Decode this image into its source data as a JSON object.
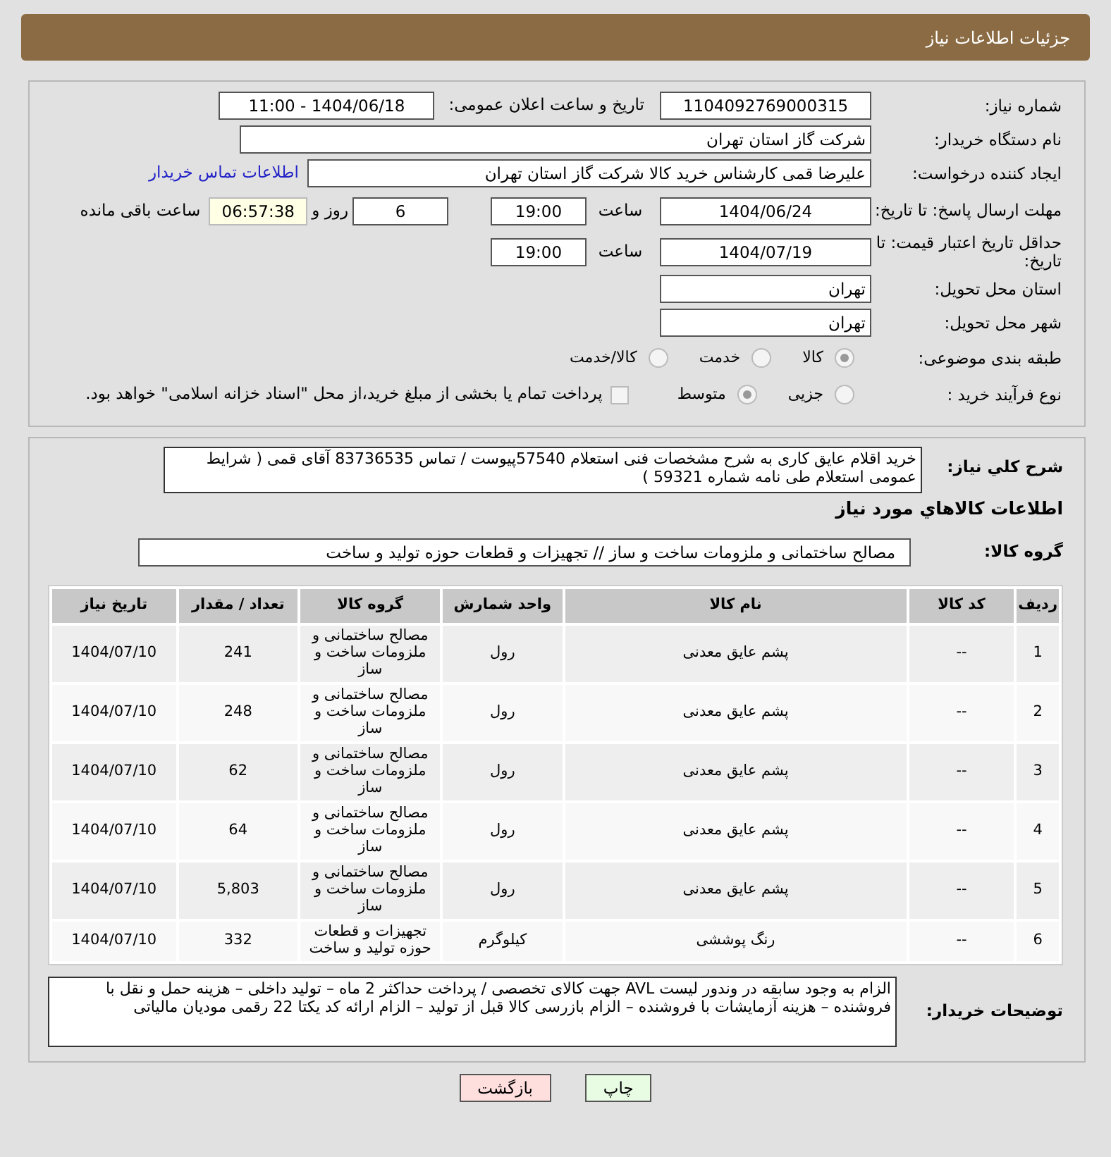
{
  "header": {
    "title": "جزئیات اطلاعات نیاز"
  },
  "details": {
    "need_number": {
      "label": "شماره نیاز:",
      "value": "1104092769000315"
    },
    "announce": {
      "label": "تاریخ و ساعت اعلان عمومی:",
      "value": "1404/06/18 - 11:00"
    },
    "buyer_org": {
      "label": "نام دستگاه خریدار:",
      "value": "شرکت گاز استان تهران"
    },
    "requester": {
      "label": "ایجاد کننده درخواست:",
      "value": "علیرضا قمی کارشناس خرید کالا شرکت گاز استان تهران",
      "link": "اطلاعات تماس خریدار"
    },
    "deadline": {
      "label": "مهلت ارسال پاسخ: تا تاریخ:",
      "date": "1404/06/24",
      "time_label": "ساعت",
      "time": "19:00",
      "days": "6",
      "days_label": "روز و",
      "remaining": "06:57:38",
      "remaining_label": "ساعت باقی مانده"
    },
    "validity": {
      "label": "حداقل تاریخ اعتبار قیمت: تا تاریخ:",
      "date": "1404/07/19",
      "time_label": "ساعت",
      "time": "19:00"
    },
    "province": {
      "label": "استان محل تحویل:",
      "value": "تهران"
    },
    "city": {
      "label": "شهر محل تحویل:",
      "value": "تهران"
    },
    "category": {
      "label": "طبقه بندی موضوعی:",
      "options": [
        {
          "label": "کالا",
          "selected": true
        },
        {
          "label": "خدمت",
          "selected": false
        },
        {
          "label": "کالا/خدمت",
          "selected": false
        }
      ]
    },
    "process": {
      "label": "نوع فرآیند خرید :",
      "options": [
        {
          "label": "جزیی",
          "selected": false
        },
        {
          "label": "متوسط",
          "selected": true
        }
      ],
      "payment": {
        "label": "پرداخت تمام یا بخشی از مبلغ خرید،از محل \"اسناد خزانه اسلامی\" خواهد بود.",
        "checked": false
      }
    }
  },
  "needs": {
    "description": {
      "label": "شرح کلي نياز:",
      "value": "خرید اقلام عایق کاری به شرح مشخصات فنی استعلام 57540پیوست / تماس 83736535 آقای قمی ( شرایط عمومی استعلام طی نامه شماره 59321 )"
    },
    "section_title": "اطلاعات کالاهاي مورد نياز",
    "group": {
      "label": "گروه کالا:",
      "value": "مصالح ساختمانی و ملزومات ساخت و ساز // تجهیزات و قطعات حوزه تولید و ساخت"
    },
    "table": {
      "columns": [
        "ردیف",
        "کد کالا",
        "نام کالا",
        "واحد شمارش",
        "گروه کالا",
        "تعداد / مقدار",
        "تاریخ نیاز"
      ],
      "rows": [
        [
          "1",
          "--",
          "پشم عایق معدنی",
          "رول",
          "مصالح ساختمانی و ملزومات ساخت و ساز",
          "241",
          "1404/07/10"
        ],
        [
          "2",
          "--",
          "پشم عایق معدنی",
          "رول",
          "مصالح ساختمانی و ملزومات ساخت و ساز",
          "248",
          "1404/07/10"
        ],
        [
          "3",
          "--",
          "پشم عایق معدنی",
          "رول",
          "مصالح ساختمانی و ملزومات ساخت و ساز",
          "62",
          "1404/07/10"
        ],
        [
          "4",
          "--",
          "پشم عایق معدنی",
          "رول",
          "مصالح ساختمانی و ملزومات ساخت و ساز",
          "64",
          "1404/07/10"
        ],
        [
          "5",
          "--",
          "پشم عایق معدنی",
          "رول",
          "مصالح ساختمانی و ملزومات ساخت و ساز",
          "5,803",
          "1404/07/10"
        ],
        [
          "6",
          "--",
          "رنگ پوششی",
          "کیلوگرم",
          "تجهیزات و قطعات حوزه تولید و ساخت",
          "332",
          "1404/07/10"
        ]
      ]
    },
    "notes": {
      "label": "توضیحات خریدار:",
      "value": "الزام به وجود سابقه در وندور لیست AVL جهت کالای تخصصی / پرداخت حداکثر 2 ماه – تولید  داخلی – هزینه حمل و نقل با فروشنده – هزینه آزمایشات با فروشنده – الزام بازرسی کالا قبل از تولید – الزام ارائه  کد یکتا  22 رقمی مودیان مالیاتی"
    }
  },
  "buttons": [
    {
      "label": "چاپ",
      "kind": "print"
    },
    {
      "label": "بازگشت",
      "kind": "back"
    }
  ]
}
